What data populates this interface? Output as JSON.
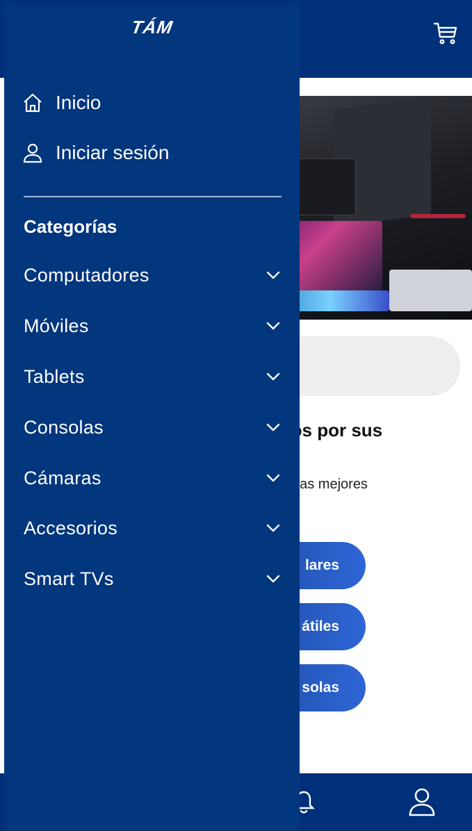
{
  "app": {
    "logo_text": "TÁM"
  },
  "drawer": {
    "links": [
      {
        "label": "Inicio",
        "icon": "home-icon"
      },
      {
        "label": "Iniciar sesión",
        "icon": "user-icon"
      }
    ],
    "categories_heading": "Categorías",
    "categories": [
      {
        "label": "Computadores"
      },
      {
        "label": "Móviles"
      },
      {
        "label": "Tablets"
      },
      {
        "label": "Consolas"
      },
      {
        "label": "Cámaras"
      },
      {
        "label": "Accesorios"
      },
      {
        "label": "Smart TVs"
      }
    ]
  },
  "background": {
    "promo_title_line1": "tos por sus",
    "promo_title_line2": "!",
    "promo_subtitle": "a las mejores",
    "buttons": [
      {
        "label": "lares"
      },
      {
        "label": "átiles"
      },
      {
        "label": "solas"
      }
    ]
  },
  "colors": {
    "drawer_bg": "#02367d",
    "bar_bg": "#00307a",
    "button_gradient_start": "#1f4ea8",
    "button_gradient_end": "#2f66d6"
  }
}
